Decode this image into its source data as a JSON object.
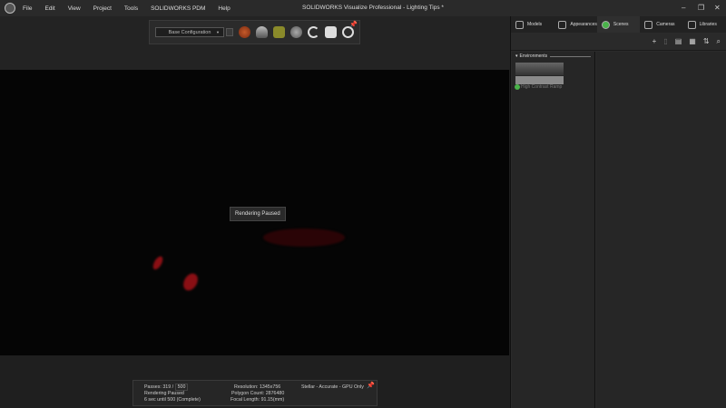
{
  "app": {
    "title": "SOLIDWORKS Visualize Professional - Lighting Tips *",
    "menu": [
      "File",
      "Edit",
      "View",
      "Project",
      "Tools",
      "SOLIDWORKS PDM",
      "Help"
    ]
  },
  "toolbar": {
    "configuration": "Base Configuration",
    "tools": [
      "appearance-sphere-icon",
      "turntable-icon",
      "box-icon",
      "camera-node-icon",
      "refresh-icon",
      "render-output-icon",
      "aperture-icon"
    ]
  },
  "viewport": {
    "overlay": "Rendering Paused"
  },
  "status": {
    "passes_label": "Passes: 319 /",
    "passes_target": "500",
    "state": "Rendering Paused",
    "eta": "6 sec until 500 (Complete)",
    "resolution": "Resolution: 1345x756",
    "polygons": "Polygon Count: 2876480",
    "focal": "Focal Length: 91.15(mm)",
    "mode": "Stellar - Accurate - GPU Only"
  },
  "panel": {
    "tabs": [
      "Models",
      "Appearances",
      "Scenes",
      "Cameras",
      "Libraries"
    ],
    "active_tab": "Scenes",
    "section": "Environments",
    "environments": [
      {
        "name": "High Contrast Ramp",
        "active": true
      }
    ]
  },
  "colors": {
    "accent": "#4ab34a",
    "render_red": "#8a0f14"
  }
}
